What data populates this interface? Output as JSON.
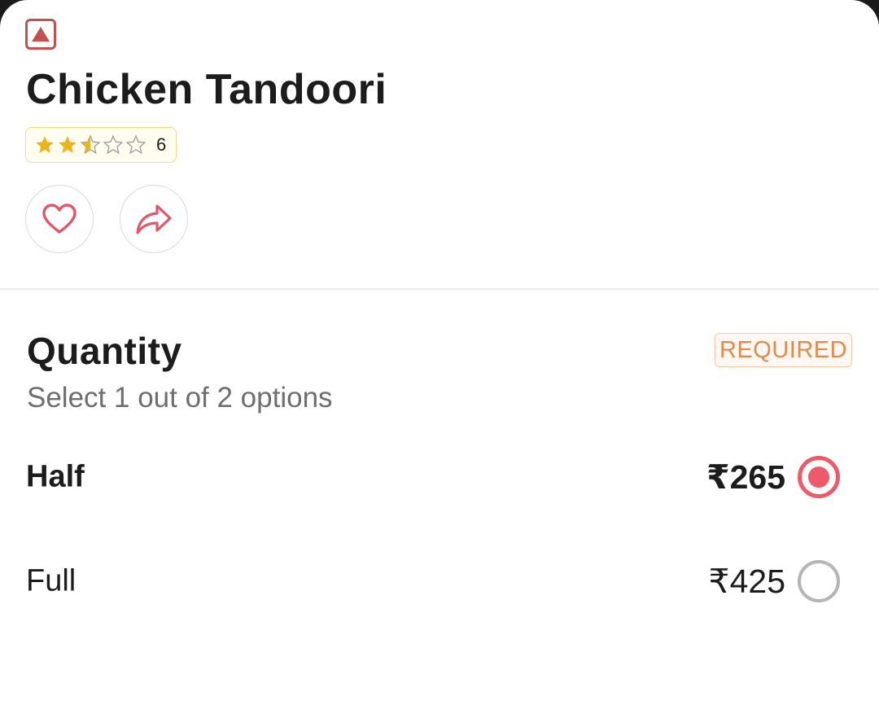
{
  "dish": {
    "title": "Chicken Tandoori",
    "diet_marker": "non-veg-icon",
    "rating": {
      "stars": 2.5,
      "max_stars": 5,
      "count": "6"
    }
  },
  "actions": {
    "favourite_icon": "heart-icon",
    "share_icon": "share-icon"
  },
  "quantity": {
    "title": "Quantity",
    "badge": "REQUIRED",
    "subtitle": "Select 1 out of 2 options",
    "options": [
      {
        "label": "Half",
        "price": "₹265",
        "selected": true
      },
      {
        "label": "Full",
        "price": "₹425",
        "selected": false
      }
    ]
  },
  "colors": {
    "accent": "#ed5a6b",
    "star": "#e9b51a",
    "non_veg": "#c0524f",
    "required": "#e08a4e"
  }
}
